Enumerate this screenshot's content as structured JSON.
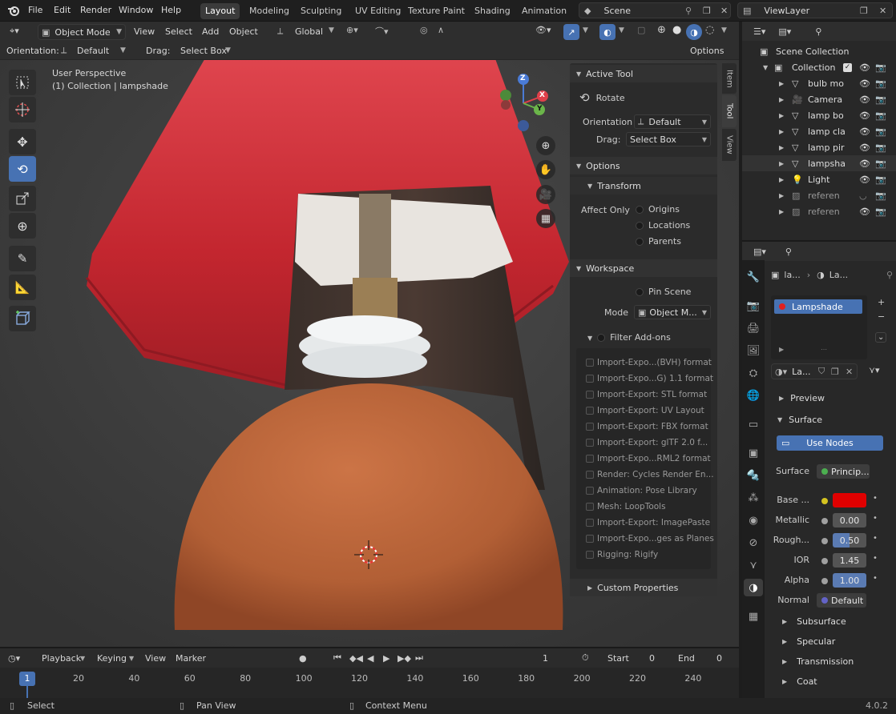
{
  "topbar": {
    "menus": [
      "File",
      "Edit",
      "Render",
      "Window",
      "Help"
    ],
    "workspaces": [
      "Layout",
      "Modeling",
      "Sculpting",
      "UV Editing",
      "Texture Paint",
      "Shading",
      "Animation"
    ],
    "active_workspace": "Layout",
    "scene": "Scene",
    "view_layer": "ViewLayer"
  },
  "viewport": {
    "mode": "Object Mode",
    "menus": [
      "View",
      "Select",
      "Add",
      "Object"
    ],
    "transform": "Global",
    "orientation_label": "Orientation:",
    "orientation": "Default",
    "drag_label": "Drag:",
    "drag": "Select Box",
    "options": "Options",
    "perspective": "User Perspective",
    "collection_info": "(1) Collection | lampshade",
    "gizmo_axes": [
      "Z",
      "X",
      "Y"
    ]
  },
  "npanel": {
    "tabs": [
      "Item",
      "Tool",
      "View"
    ],
    "active_tab": "Tool",
    "active_tool_header": "Active Tool",
    "active_tool": "Rotate",
    "orientation_label": "Orientation",
    "orientation": "Default",
    "drag_label": "Drag:",
    "drag": "Select Box",
    "options_header": "Options",
    "transform_header": "Transform",
    "affect_only_label": "Affect Only",
    "affect_only": [
      "Origins",
      "Locations",
      "Parents"
    ],
    "workspace_header": "Workspace",
    "pin_scene": "Pin Scene",
    "mode_label": "Mode",
    "mode": "Object M...",
    "filter_addons": "Filter Add-ons",
    "addons": [
      "Import-Expo...(BVH) format",
      "Import-Expo...G) 1.1 format",
      "Import-Export: STL format",
      "Import-Export: UV Layout",
      "Import-Export: FBX format",
      "Import-Export: glTF 2.0 f...",
      "Import-Expo...RML2 format",
      "Render: Cycles Render En...",
      "Animation: Pose Library",
      "Mesh: LoopTools",
      "Import-Export: ImagePaste",
      "Import-Expo...ges as Planes",
      "Rigging: Rigify"
    ],
    "custom_properties": "Custom Properties"
  },
  "outliner": {
    "root": "Scene Collection",
    "collection": "Collection",
    "items": [
      "bulb mo",
      "Camera",
      "lamp bo",
      "lamp cla",
      "lamp pir",
      "lampsha",
      "Light",
      "referen",
      "referen"
    ]
  },
  "properties": {
    "breadcrumb_object": "la...",
    "breadcrumb_material": "La...",
    "material_slot": "Lampshade",
    "material_name": "La...",
    "preview": "Preview",
    "surface_header": "Surface",
    "use_nodes": "Use Nodes",
    "surface_label": "Surface",
    "surface_value": "Princip...",
    "base_color_label": "Base ...",
    "base_color": "#e00000",
    "metallic_label": "Metallic",
    "metallic": "0.00",
    "roughness_label": "Rough...",
    "roughness": "0.50",
    "ior_label": "IOR",
    "ior": "1.45",
    "alpha_label": "Alpha",
    "alpha": "1.00",
    "normal_label": "Normal",
    "normal": "Default",
    "subsections": [
      "Subsurface",
      "Specular",
      "Transmission",
      "Coat"
    ]
  },
  "timeline": {
    "menus": [
      "Playback",
      "Keying",
      "View",
      "Marker"
    ],
    "current_frame": "1",
    "start_label": "Start",
    "start": "0",
    "end_label": "End",
    "end": "0",
    "frame_marker": "1",
    "ticks": [
      "20",
      "40",
      "60",
      "80",
      "100",
      "120",
      "140",
      "160",
      "180",
      "200",
      "220",
      "240"
    ]
  },
  "status": {
    "select": "Select",
    "pan": "Pan View",
    "context": "Context Menu",
    "version": "4.0.2"
  },
  "colors": {
    "accent": "#4772b3",
    "lampshade": "#c92b33",
    "lamp_base": "#c06a3d"
  }
}
